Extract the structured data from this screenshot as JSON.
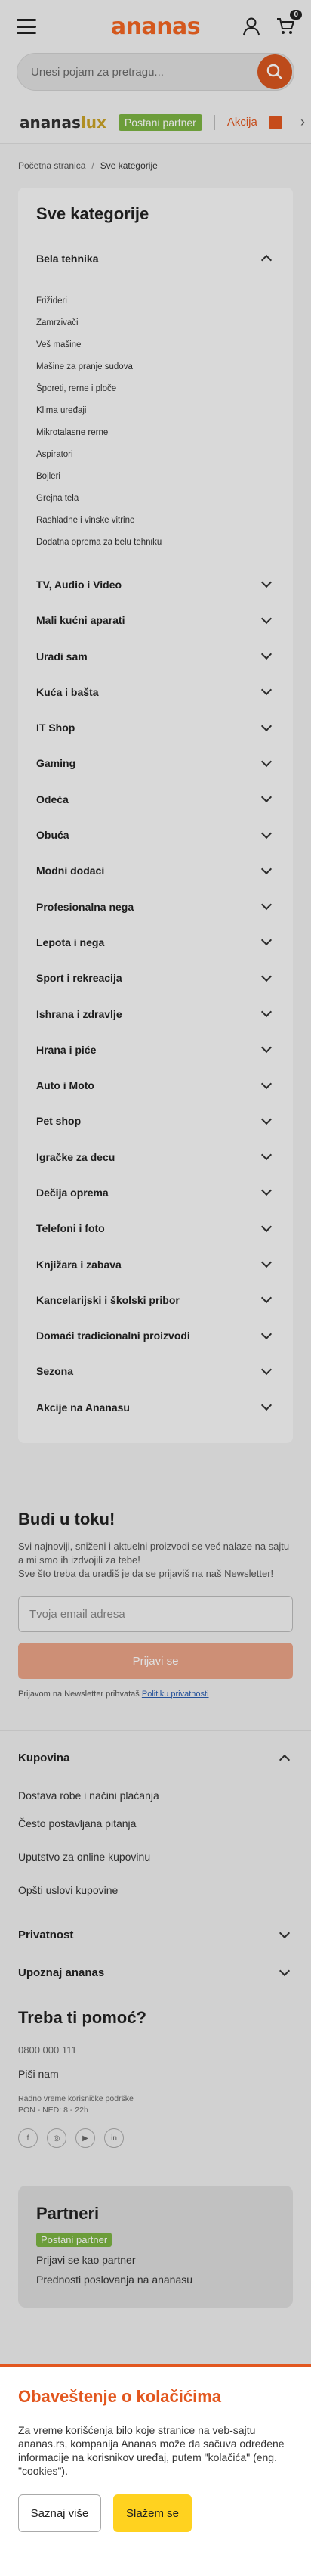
{
  "header": {
    "logo": "ananas",
    "cart_count": "0"
  },
  "search": {
    "placeholder": "Unesi pojam za pretragu..."
  },
  "promo": {
    "lux_logo_main": "ananas",
    "lux_logo_accent": "lux",
    "partner": "Postani partner",
    "akcija": "Akcija"
  },
  "breadcrumb": {
    "home": "Početna stranica",
    "current": "Sve kategorije"
  },
  "categories": {
    "title": "Sve kategorije",
    "open_label": "Bela tehnika",
    "subitems": [
      "Frižideri",
      "Zamrzivači",
      "Veš mašine",
      "Mašine za pranje sudova",
      "Šporeti, rerne i ploče",
      "Klima uređaji",
      "Mikrotalasne rerne",
      "Aspiratori",
      "Bojleri",
      "Grejna tela",
      "Rashladne i vinske vitrine",
      "Dodatna oprema za belu tehniku"
    ],
    "items": [
      "TV, Audio i Video",
      "Mali kućni aparati",
      "Uradi sam",
      "Kuća i bašta",
      "IT Shop",
      "Gaming",
      "Odeća",
      "Obuća",
      "Modni dodaci",
      "Profesionalna nega",
      "Lepota i nega",
      "Sport i rekreacija",
      "Ishrana i zdravlje",
      "Hrana i piće",
      "Auto i Moto",
      "Pet shop",
      "Igračke za decu",
      "Dečija oprema",
      "Telefoni i foto",
      "Knjižara i zabava",
      "Kancelarijski i školski pribor",
      "Domaći tradicionalni proizvodi",
      "Sezona",
      "Akcije na Ananasu"
    ]
  },
  "newsletter": {
    "title": "Budi u toku!",
    "text_1": "Svi najnoviji, sniženi i aktuelni proizvodi se već nalaze na sajtu a mi smo ih izdvojili za tebe!",
    "text_2": "Sve što treba da uradiš je da se prijaviš na naš Newsletter!",
    "email_placeholder": "Tvoja email adresa",
    "button": "Prijavi se",
    "consent_text": "Prijavom na Newsletter prihvataš",
    "consent_link": "Politiku privatnosti"
  },
  "footer": {
    "kupovina": {
      "title": "Kupovina",
      "links": [
        "Dostava robe i načini plaćanja",
        "Često postavljana pitanja",
        "Uputstvo za online kupovinu",
        "Opšti uslovi kupovine"
      ]
    },
    "privatnost": "Privatnost",
    "upoznaj": "Upoznaj ananas"
  },
  "help": {
    "title": "Treba ti pomoć?",
    "phone": "0800 000 111",
    "write": "Piši nam",
    "hours_1": "Radno vreme korisničke podrške",
    "hours_2": "PON - NED: 8 - 22h"
  },
  "partners": {
    "title": "Partneri",
    "pill": "Postani partner",
    "link_1": "Prijavi se kao partner",
    "link_2": "Prednosti poslovanja na ananasu"
  },
  "cookie": {
    "title": "Obaveštenje o kolačićima",
    "text": "Za vreme korišćenja bilo koje stranice na veb-sajtu ananas.rs, kompanija Ananas može da sačuva određene informacije na korisnikov uređaj, putem \"kolačića\" (eng. \"cookies\").",
    "more": "Saznaj više",
    "agree": "Slažem se"
  },
  "colors": {
    "brand": "#f26522",
    "partner_green": "#7cb342",
    "cookie_yellow": "#ffd21f"
  }
}
